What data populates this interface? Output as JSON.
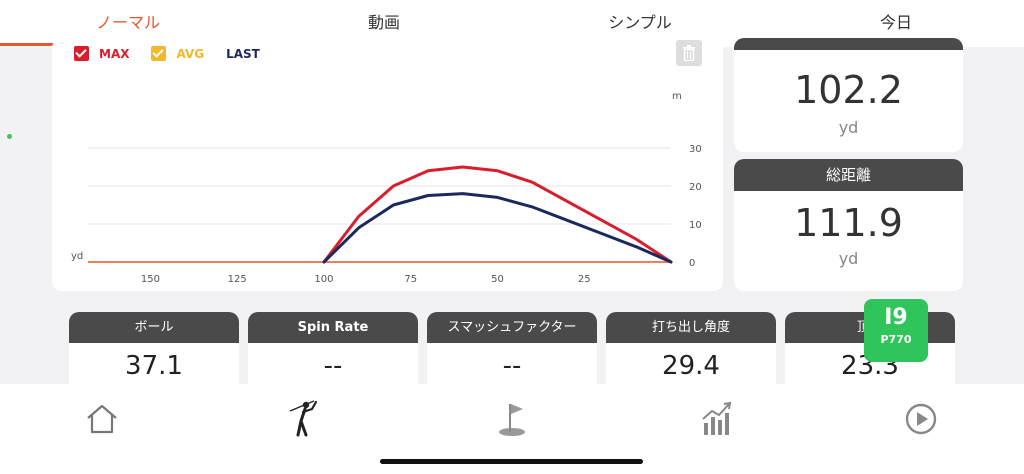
{
  "tabs": [
    {
      "label": "ノーマル",
      "active": true
    },
    {
      "label": "動画",
      "active": false
    },
    {
      "label": "シンプル",
      "active": false
    },
    {
      "label": "今日",
      "active": false
    }
  ],
  "legend": {
    "max": {
      "label": "MAX",
      "color": "#d81e2c"
    },
    "avg": {
      "label": "AVG",
      "color": "#f5b62a"
    },
    "last": {
      "label": "LAST",
      "color": "#1b2a5e"
    }
  },
  "chart_data": {
    "type": "line",
    "x_unit": "yd",
    "y_unit": "m",
    "x_ticks": [
      150,
      125,
      100,
      75,
      50,
      25
    ],
    "y_ticks": [
      0,
      10,
      20,
      30
    ],
    "xlim": [
      168,
      0
    ],
    "ylim": [
      0,
      30
    ],
    "series": [
      {
        "name": "MAX",
        "color": "#d81e2c",
        "x": [
          100,
          90,
          80,
          70,
          60,
          50,
          40,
          30,
          20,
          10,
          0
        ],
        "y": [
          0,
          12,
          20,
          24,
          25,
          24,
          21,
          16,
          11,
          6,
          0
        ]
      },
      {
        "name": "LAST",
        "color": "#1b2a5e",
        "x": [
          100,
          90,
          80,
          70,
          60,
          50,
          40,
          30,
          20,
          10,
          0
        ],
        "y": [
          0,
          9,
          15,
          17.5,
          18,
          17,
          14.5,
          11,
          7.5,
          4,
          0
        ]
      }
    ]
  },
  "stats": [
    {
      "label": "",
      "value": "102.2",
      "unit": "yd"
    },
    {
      "label": "総距離",
      "value": "111.9",
      "unit": "yd"
    }
  ],
  "metrics": [
    {
      "label": "ボール",
      "value": "37.1"
    },
    {
      "label": "Spin Rate",
      "value": "--"
    },
    {
      "label": "スマッシュファクター",
      "value": "--"
    },
    {
      "label": "打ち出し角度",
      "value": "29.4"
    },
    {
      "label": "頂",
      "value": "23.3"
    }
  ],
  "club": {
    "number": "I9",
    "name": "P770"
  },
  "nav": [
    "home-icon",
    "golfer-icon",
    "course-flag-icon",
    "stats-chart-icon",
    "play-icon"
  ]
}
